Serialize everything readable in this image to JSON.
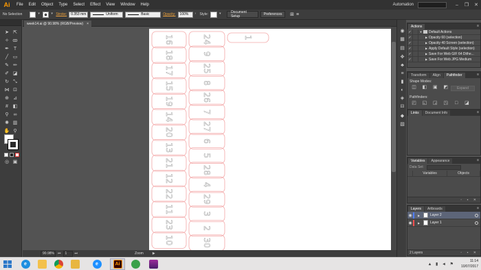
{
  "app": {
    "logo": "Ai"
  },
  "menu": [
    "File",
    "Edit",
    "Object",
    "Type",
    "Select",
    "Effect",
    "View",
    "Window",
    "Help"
  ],
  "workspace": {
    "label": "Automation"
  },
  "control": {
    "selection": "No Selection",
    "stroke_label": "Stroke:",
    "stroke_weight": "0.353 mm",
    "profile_uniform": "Uniform",
    "brush_basic": "Basic",
    "opacity_label": "Opacity:",
    "opacity_value": "100%",
    "style_label": "Style:",
    "doc_setup": "Document Setup",
    "preferences": "Preferences"
  },
  "document": {
    "tab_title": "week14.ai @ 90.98% (RGB/Preview)",
    "close": "×",
    "zoom_value": "90.98%",
    "page_value": "1",
    "status": "Zoom"
  },
  "artboard_labels": {
    "col1": [
      "16",
      "18",
      "17",
      "15",
      "19",
      "14",
      "20",
      "13",
      "21",
      "12",
      "22",
      "11",
      "23",
      "10"
    ],
    "col2": [
      "24",
      "9",
      "25",
      "8",
      "26",
      "7",
      "27",
      "6",
      "5",
      "28",
      "4",
      "29",
      "3",
      "2",
      "30"
    ],
    "col3": [
      "1"
    ]
  },
  "actions_panel": {
    "tab": "Actions",
    "set_name": "Default Actions",
    "items": [
      "Opacity 60 (selection)",
      "Opacity 40 Screen (selection)",
      "Apply Default Style (selection)",
      "Save For Web GIF 64 Dithe...",
      "Save For Web JPG Medium"
    ]
  },
  "pathfinder_panel": {
    "tabs": [
      "Transform",
      "Align",
      "Pathfinder"
    ],
    "shape_modes": "Shape Modes:",
    "pathfinders": "Pathfinders:",
    "expand": "Expand"
  },
  "links_panel": {
    "tabs": [
      "Links",
      "Document Info"
    ]
  },
  "variables_panel": {
    "tabs": [
      "Variables",
      "Appearance"
    ],
    "dataset_label": "Data Set:",
    "col_variables": "Variables",
    "col_objects": "Objects"
  },
  "layers_panel": {
    "tabs": [
      "Layers",
      "Artboards"
    ],
    "layers": [
      {
        "name": "Layer 2",
        "color": "#4f7dff"
      },
      {
        "name": "Layer 1",
        "color": "#ff4f4f"
      }
    ],
    "footer": "2 Layers"
  },
  "taskbar": {
    "time": "11:14",
    "date": "10/07/2017",
    "apps": [
      "ie",
      "explorer",
      "chrome",
      "folder",
      "ie-alt",
      "illustrator",
      "green-app",
      "stack-app"
    ]
  },
  "colors": {
    "menubar": "#323232",
    "panel": "#4b4b4b",
    "canvas": "#535353",
    "accent_orange": "#f2a33a",
    "shape_stroke": "#f3a6a6"
  }
}
